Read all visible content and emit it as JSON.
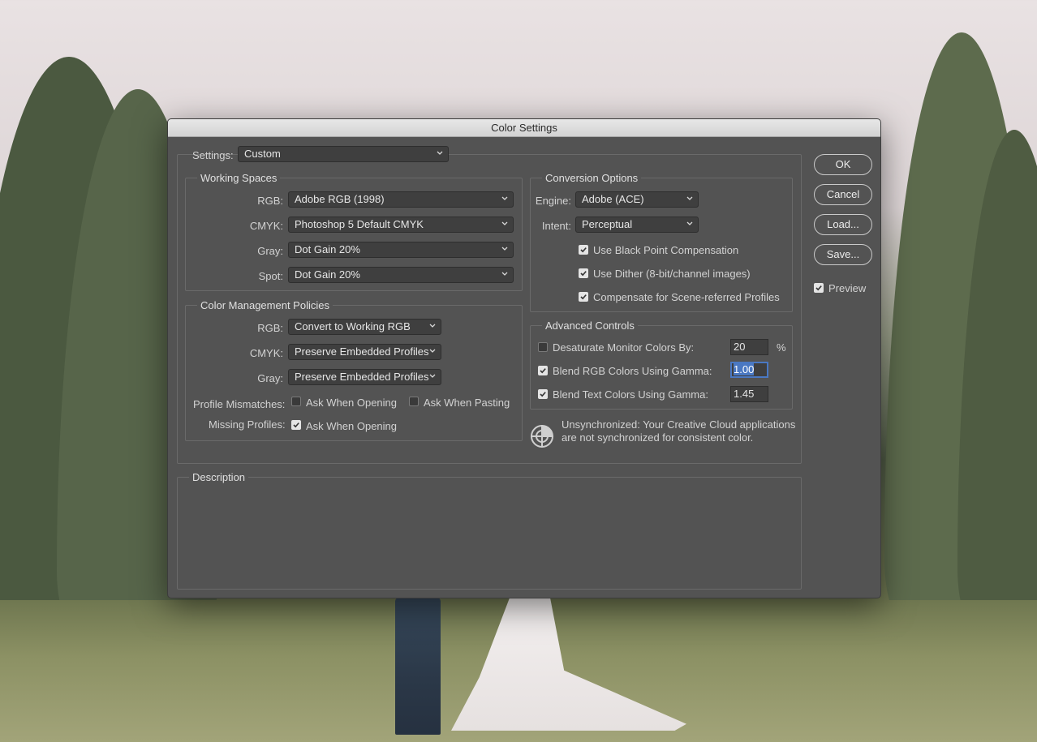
{
  "window": {
    "title": "Color Settings"
  },
  "settings": {
    "label": "Settings:",
    "value": "Custom"
  },
  "working_spaces": {
    "title": "Working Spaces",
    "rows": [
      {
        "label": "RGB:",
        "value": "Adobe RGB (1998)"
      },
      {
        "label": "CMYK:",
        "value": "Photoshop 5 Default CMYK"
      },
      {
        "label": "Gray:",
        "value": "Dot Gain 20%"
      },
      {
        "label": "Spot:",
        "value": "Dot Gain 20%"
      }
    ]
  },
  "policies": {
    "title": "Color Management Policies",
    "rows": [
      {
        "label": "RGB:",
        "value": "Convert to Working RGB"
      },
      {
        "label": "CMYK:",
        "value": "Preserve Embedded Profiles"
      },
      {
        "label": "Gray:",
        "value": "Preserve Embedded Profiles"
      }
    ],
    "profile_mismatches": {
      "label": "Profile Mismatches:",
      "ask_opening": {
        "label": "Ask When Opening",
        "checked": false
      },
      "ask_pasting": {
        "label": "Ask When Pasting",
        "checked": false
      }
    },
    "missing_profiles": {
      "label": "Missing Profiles:",
      "ask_opening": {
        "label": "Ask When Opening",
        "checked": true
      }
    }
  },
  "conversion": {
    "title": "Conversion Options",
    "engine": {
      "label": "Engine:",
      "value": "Adobe (ACE)"
    },
    "intent": {
      "label": "Intent:",
      "value": "Perceptual"
    },
    "black_point": {
      "label": "Use Black Point Compensation",
      "checked": true
    },
    "dither": {
      "label": "Use Dither (8-bit/channel images)",
      "checked": true
    },
    "scene_referred": {
      "label": "Compensate for Scene-referred Profiles",
      "checked": true
    }
  },
  "advanced": {
    "title": "Advanced Controls",
    "desaturate": {
      "label": "Desaturate Monitor Colors By:",
      "checked": false,
      "value": "20",
      "unit": "%"
    },
    "blend_rgb": {
      "label": "Blend RGB Colors Using Gamma:",
      "checked": true,
      "value": "1.00"
    },
    "blend_text": {
      "label": "Blend Text Colors Using Gamma:",
      "checked": true,
      "value": "1.45"
    }
  },
  "sync_message": {
    "line1": "Unsynchronized: Your Creative Cloud applications",
    "line2": "are not synchronized for consistent color.",
    "icon": "color-sync-icon"
  },
  "description": {
    "title": "Description"
  },
  "buttons": {
    "ok": "OK",
    "cancel": "Cancel",
    "load": "Load...",
    "save": "Save..."
  },
  "preview": {
    "label": "Preview",
    "checked": true
  }
}
